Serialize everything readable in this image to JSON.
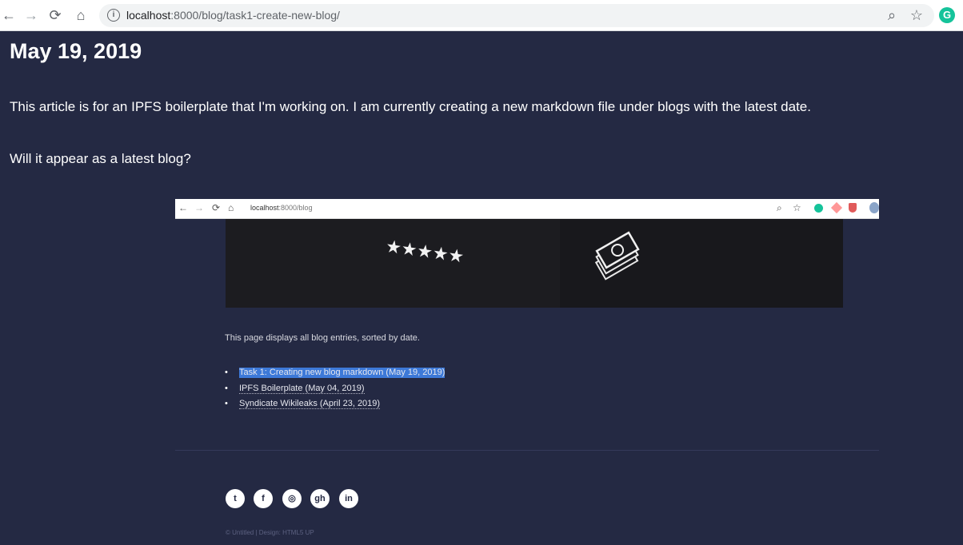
{
  "browser": {
    "back_icon": "back-arrow-icon",
    "forward_icon": "forward-arrow-icon",
    "reload_icon": "reload-icon",
    "home_icon": "home-icon",
    "url_host": "localhost",
    "url_path": ":8000/blog/task1-create-new-blog/",
    "zoom_icon": "zoom-icon",
    "bookmark_icon": "star-icon",
    "extension_letter": "G"
  },
  "article": {
    "date": "May 19, 2019",
    "paragraph1": "This article is for an IPFS boilerplate that I'm working on. I am currently creating a new markdown file under blogs with the latest date.",
    "paragraph2": "Will it appear as a latest blog?"
  },
  "embedded_screenshot": {
    "url_host": "localhost",
    "url_path": ":8000/blog",
    "intro": "This page displays all blog entries, sorted by date.",
    "entries": [
      "Task 1: Creating new blog markdown (May 19, 2019)",
      "IPFS Boilerplate (May 04, 2019)",
      "Syndicate Wikileaks (April 23, 2019)"
    ],
    "social_icons": [
      "twitter-icon",
      "facebook-icon",
      "instagram-icon",
      "github-icon",
      "linkedin-icon"
    ],
    "social_labels": [
      "t",
      "f",
      "◎",
      "gh",
      "in"
    ],
    "footer": "© Untitled   |   Design: HTML5 UP"
  },
  "colors": {
    "page_bg": "#242943",
    "selection": "#3d79d8"
  }
}
